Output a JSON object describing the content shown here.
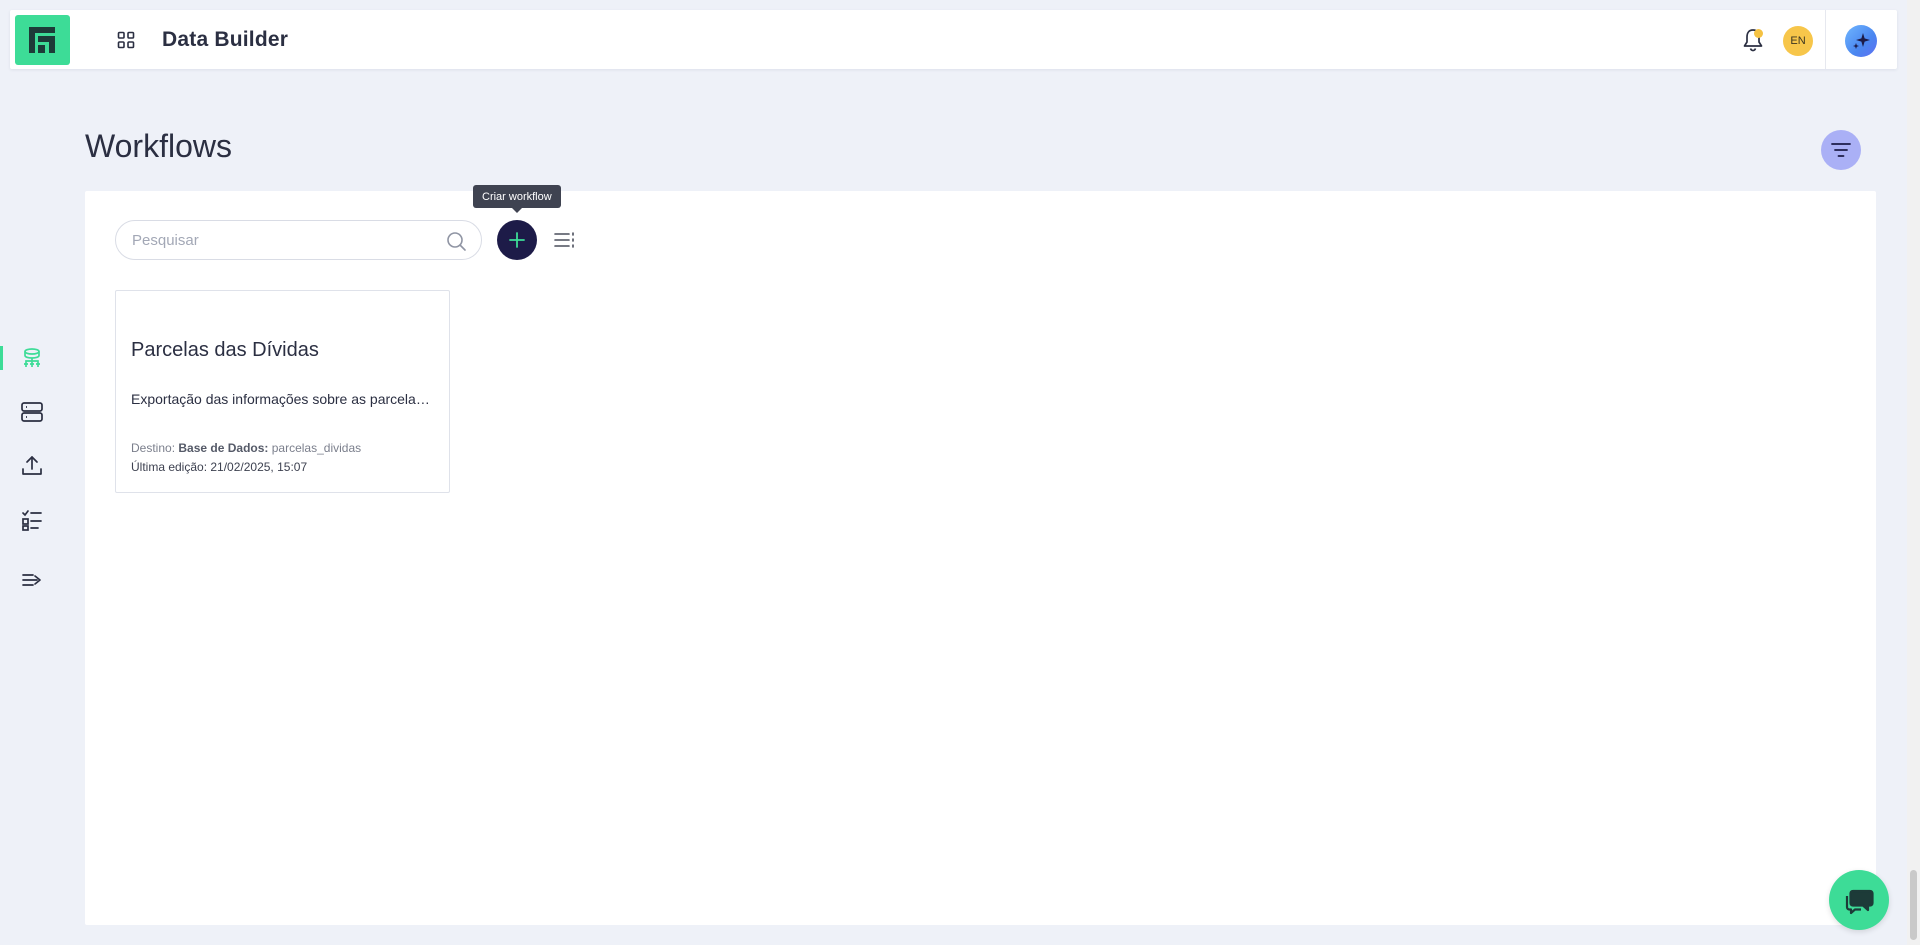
{
  "header": {
    "app_title": "Data Builder",
    "lang_label": "EN",
    "icons": {
      "logo": "brand-logo-icon",
      "apps": "grid-apps-icon",
      "bell": "bell-icon",
      "ai": "sparkle-icon"
    },
    "colors": {
      "brand": "#3ddc97",
      "notification_dot": "#f5c242",
      "lang_badge": "#f7c64a"
    }
  },
  "sidebar": {
    "items": [
      {
        "name": "workflows",
        "icon": "data-flow-icon",
        "active": true
      },
      {
        "name": "databases",
        "icon": "server-icon",
        "active": false
      },
      {
        "name": "uploads",
        "icon": "upload-icon",
        "active": false
      },
      {
        "name": "tasks",
        "icon": "checklist-icon",
        "active": false
      },
      {
        "name": "expand",
        "icon": "expand-menu-icon",
        "active": false
      }
    ]
  },
  "page": {
    "title": "Workflows",
    "filter_icon": "filter-icon"
  },
  "toolbar": {
    "search_placeholder": "Pesquisar",
    "search_value": "",
    "add_tooltip": "Criar workflow",
    "add_icon": "plus-icon",
    "view_icon": "list-view-icon",
    "colors": {
      "add_button": "#1d1b48",
      "add_plus": "#3ddc97"
    }
  },
  "workflows": [
    {
      "title": "Parcelas das Dívidas",
      "description": "Exportação das informações sobre as parcelas das dívidas",
      "destination_prefix": "Destino:",
      "destination_type": "Base de Dados:",
      "destination_name": "parcelas_dividas",
      "last_edit": "Última edição: 21/02/2025, 15:07"
    }
  ],
  "chat": {
    "icon": "chat-bubble-icon"
  }
}
